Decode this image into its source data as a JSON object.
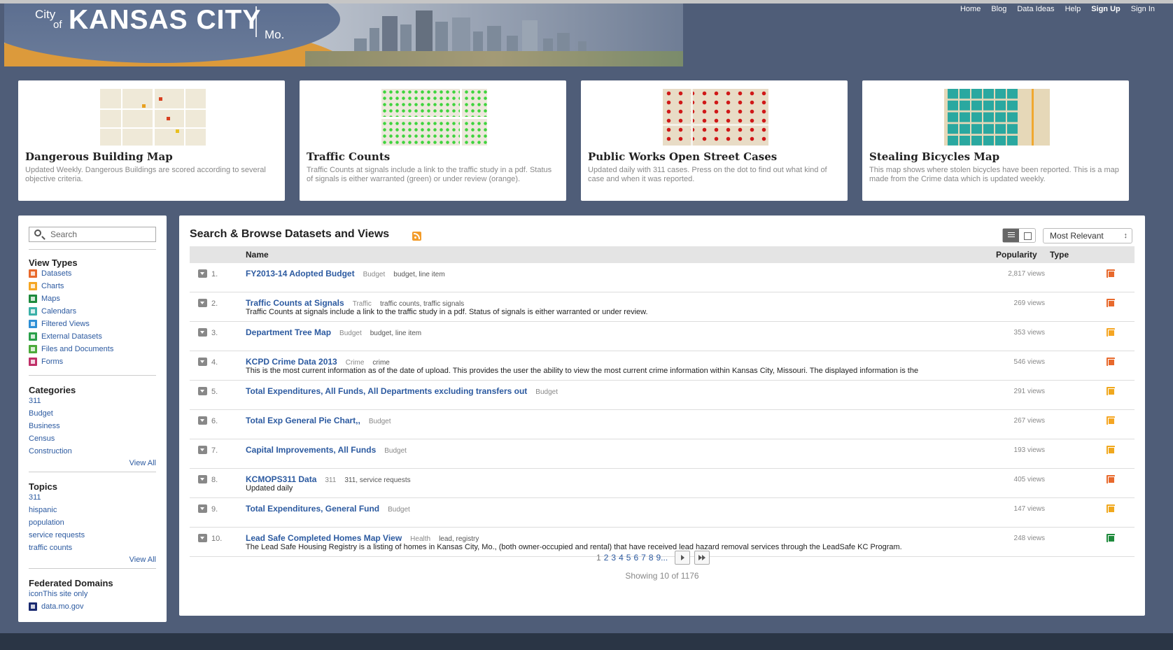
{
  "logo": {
    "city": "City",
    "of": "of",
    "name": "KANSAS CITY",
    "state": "Mo."
  },
  "nav": [
    "Home",
    "Blog",
    "Data Ideas",
    "Help",
    "Sign Up",
    "Sign In"
  ],
  "cards": [
    {
      "title": "Dangerous Building Map",
      "desc": "Updated Weekly. Dangerous Buildings are scored according to several objective criteria."
    },
    {
      "title": "Traffic Counts",
      "desc": "Traffic Counts at signals include a link to the traffic study in a pdf. Status of signals is either warranted (green) or under review (orange)."
    },
    {
      "title": "Public Works Open Street Cases",
      "desc": "Updated daily with 311 cases. Press on the dot to find out what kind of case and when it was reported."
    },
    {
      "title": "Stealing Bicycles Map",
      "desc": "This map shows where stolen bicycles have been reported. This is a map made from the Crime data which is updated weekly."
    }
  ],
  "sidebar": {
    "search_placeholder": "Search",
    "view_types_title": "View Types",
    "view_types": [
      {
        "label": "Datasets",
        "color": "#e8692c"
      },
      {
        "label": "Charts",
        "color": "#f5a623"
      },
      {
        "label": "Maps",
        "color": "#1e8a3c"
      },
      {
        "label": "Calendars",
        "color": "#3ab0a8"
      },
      {
        "label": "Filtered Views",
        "color": "#2d8fd5"
      },
      {
        "label": "External Datasets",
        "color": "#2aa04a"
      },
      {
        "label": "Files and Documents",
        "color": "#4caa3a"
      },
      {
        "label": "Forms",
        "color": "#c03068"
      }
    ],
    "categories_title": "Categories",
    "categories": [
      "311",
      "Budget",
      "Business",
      "Census",
      "Construction"
    ],
    "topics_title": "Topics",
    "topics": [
      "311",
      "hispanic",
      "population",
      "service requests",
      "traffic counts"
    ],
    "view_all": "View All",
    "federated_title": "Federated Domains",
    "federated": [
      "iconThis site only",
      "data.mo.gov"
    ]
  },
  "main": {
    "title": "Search & Browse Datasets and Views",
    "sort_label": "Most Relevant",
    "col_name": "Name",
    "col_popularity": "Popularity",
    "col_type": "Type",
    "rows": [
      {
        "num": "1.",
        "name": "FY2013-14 Adopted Budget",
        "category": "Budget",
        "tags": "budget, line item",
        "desc": "",
        "views": "2,817 views",
        "type_color": "#e8692c"
      },
      {
        "num": "2.",
        "name": "Traffic Counts at Signals",
        "category": "Traffic",
        "tags": "traffic counts, traffic signals",
        "desc": "Traffic Counts at signals include a link to the traffic study in a pdf. Status of signals is either warranted or under review.",
        "views": "269 views",
        "type_color": "#e8692c"
      },
      {
        "num": "3.",
        "name": "Department Tree Map",
        "category": "Budget",
        "tags": "budget, line item",
        "desc": "",
        "views": "353 views",
        "type_color": "#f5a623"
      },
      {
        "num": "4.",
        "name": "KCPD Crime Data 2013",
        "category": "Crime",
        "tags": "crime",
        "desc": "This is the most current information as of the date of upload. This provides the user the ability to view the most current crime information within Kansas City, Missouri. The displayed information is the",
        "views": "546 views",
        "type_color": "#e8692c"
      },
      {
        "num": "5.",
        "name": "Total Expenditures, All Funds, All Departments excluding transfers out",
        "category": "Budget",
        "tags": "",
        "desc": "",
        "views": "291 views",
        "type_color": "#f0a81e"
      },
      {
        "num": "6.",
        "name": "Total Exp General Pie Chart,,",
        "category": "Budget",
        "tags": "",
        "desc": "",
        "views": "267 views",
        "type_color": "#f5a623"
      },
      {
        "num": "7.",
        "name": "Capital Improvements, All Funds",
        "category": "Budget",
        "tags": "",
        "desc": "",
        "views": "193 views",
        "type_color": "#f0a81e"
      },
      {
        "num": "8.",
        "name": "KCMOPS311 Data",
        "category": "311",
        "tags": "311, service requests",
        "desc": "Updated daily",
        "views": "405 views",
        "type_color": "#e8692c"
      },
      {
        "num": "9.",
        "name": "Total Expenditures, General Fund",
        "category": "Budget",
        "tags": "",
        "desc": "",
        "views": "147 views",
        "type_color": "#f0a81e"
      },
      {
        "num": "10.",
        "name": "Lead Safe Completed Homes Map View",
        "category": "Health",
        "tags": "lead, registry",
        "desc": "The Lead Safe Housing Registry is a listing of homes in Kansas City, Mo., (both owner-occupied and rental) that have received lead hazard removal services through the LeadSafe KC Program.",
        "views": "248 views",
        "type_color": "#1e8a3c"
      }
    ],
    "pages": [
      "1",
      "2",
      "3",
      "4",
      "5",
      "6",
      "7",
      "8",
      "9..."
    ],
    "showing": "Showing 10 of 1176"
  }
}
